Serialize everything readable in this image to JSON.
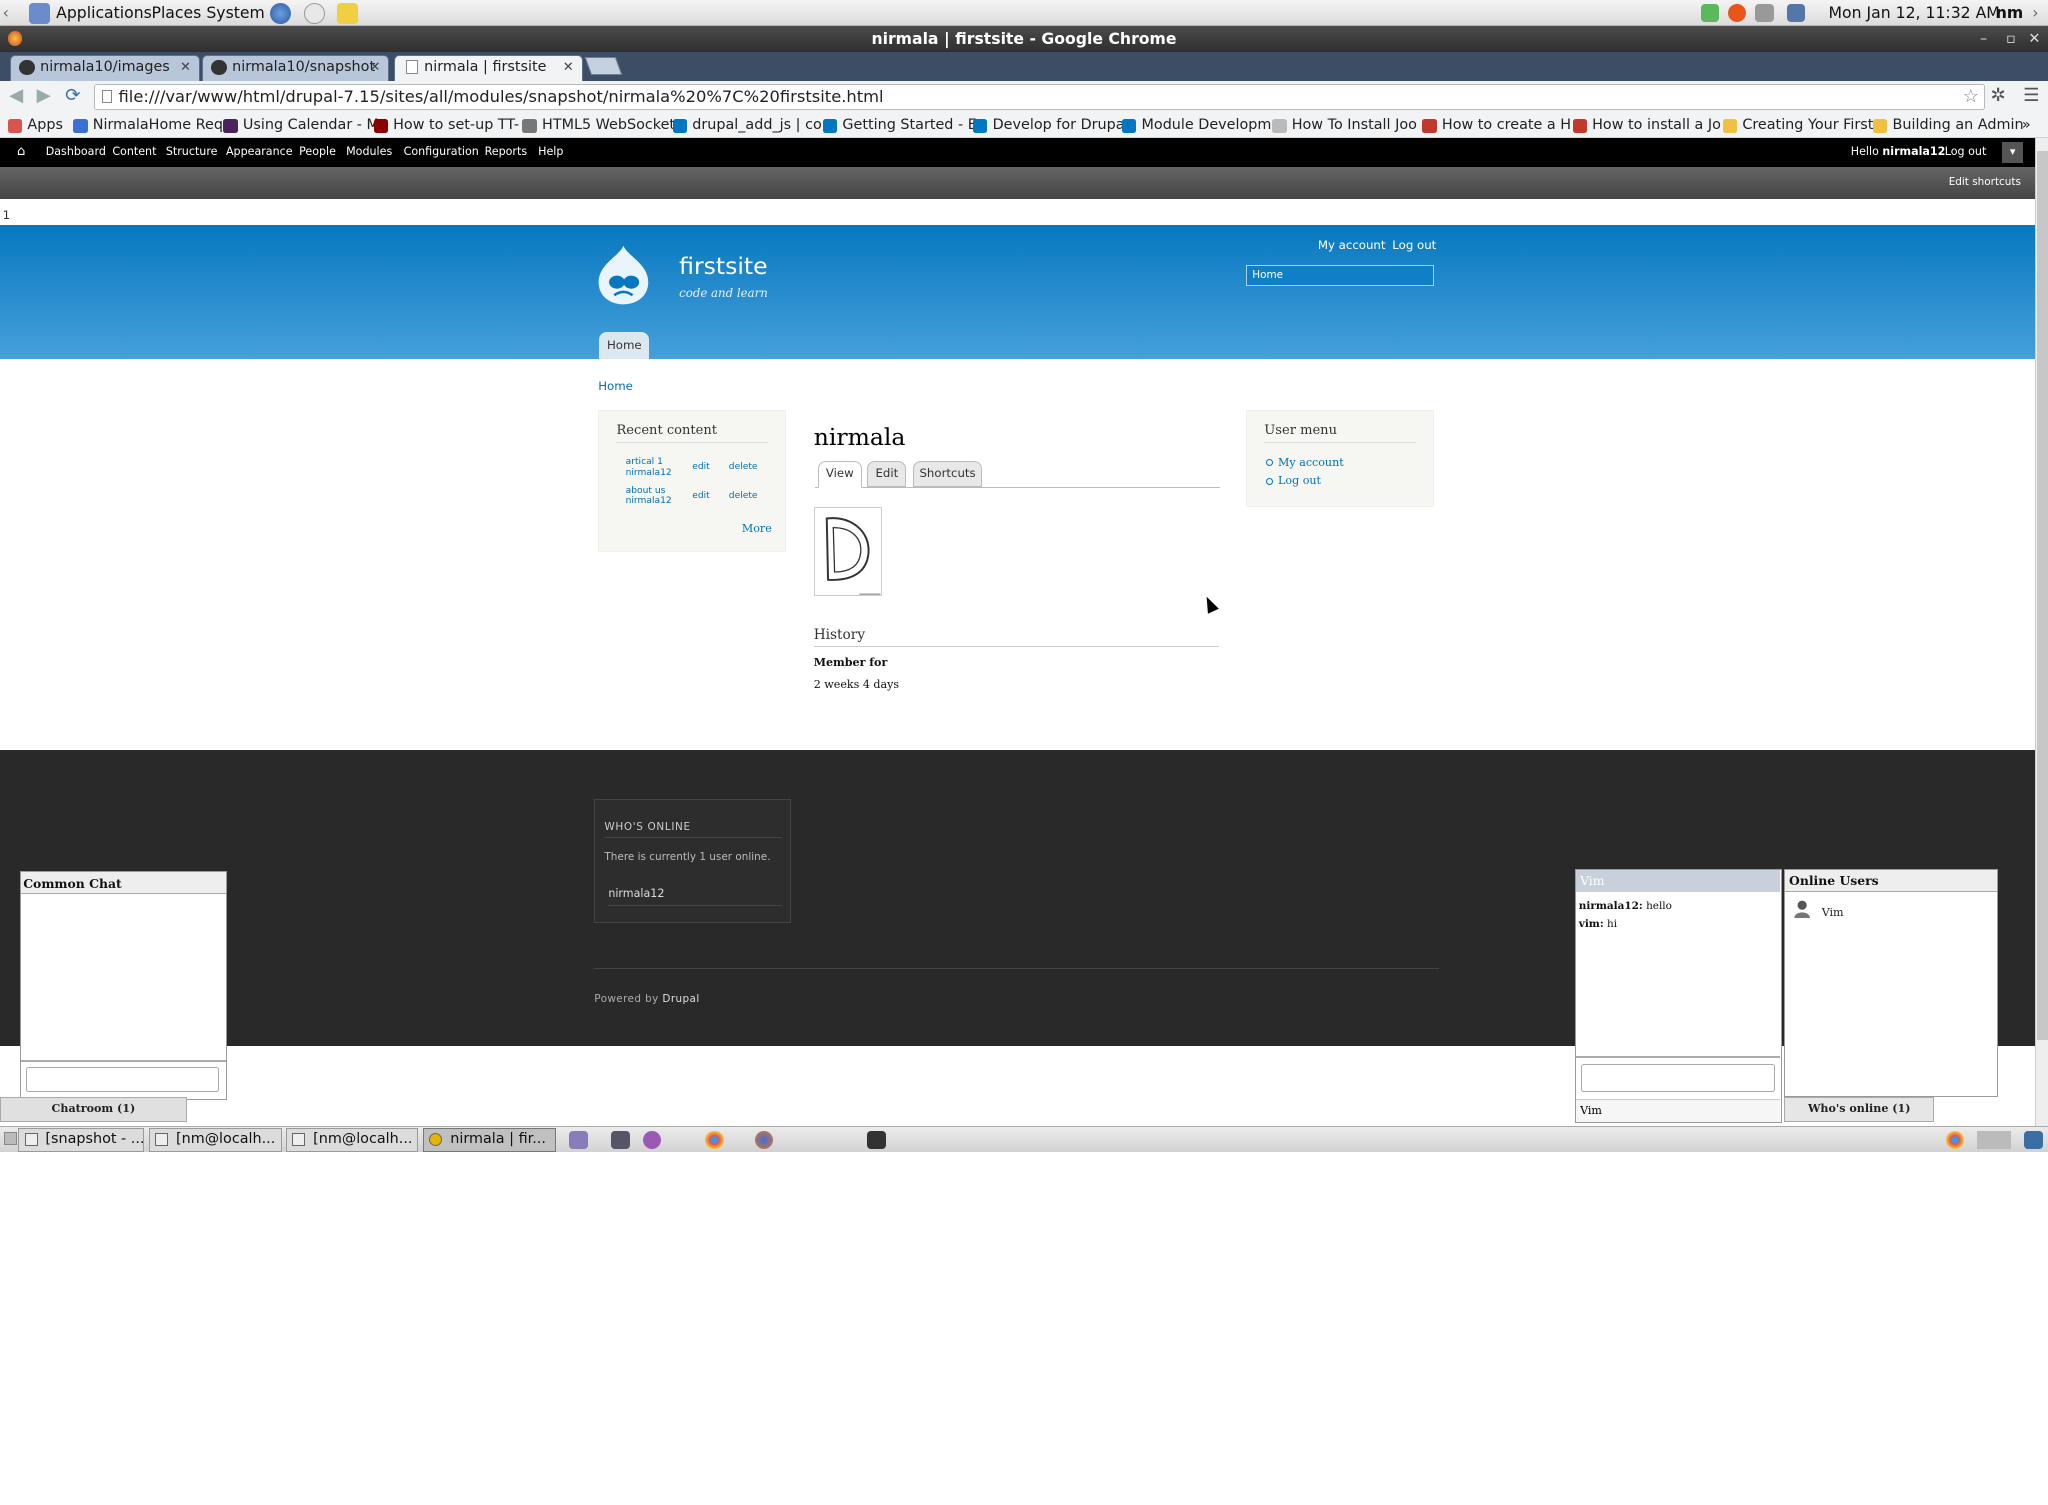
{
  "gnome_panel": {
    "menus": [
      "Applications",
      "Places",
      "System"
    ],
    "clock": "Mon Jan 12, 11:32 AM",
    "user": "nm"
  },
  "window": {
    "title": "nirmala | firstsite - Google Chrome"
  },
  "tabs": [
    {
      "label": "nirmala10/images"
    },
    {
      "label": "nirmala10/snapshot"
    },
    {
      "label": "nirmala | firstsite"
    }
  ],
  "url": "file:///var/www/html/drupal-7.15/sites/all/modules/snapshot/nirmala%20%7C%20firstsite.html",
  "bookmarks": [
    {
      "label": "Apps",
      "color": "#d9534f"
    },
    {
      "label": "NirmalaHome Req",
      "color": "#3b6fd6"
    },
    {
      "label": "Using Calendar - M",
      "color": "#4a235a"
    },
    {
      "label": "How to set-up TT-",
      "color": "#8b0000"
    },
    {
      "label": "HTML5 WebSocket",
      "color": "#777777"
    },
    {
      "label": "drupal_add_js | co",
      "color": "#0077c0"
    },
    {
      "label": "Getting Started - E",
      "color": "#0077c0"
    },
    {
      "label": "Develop for Drupa",
      "color": "#0077c0"
    },
    {
      "label": "Module Developm",
      "color": "#0077c0"
    },
    {
      "label": "How To Install Joo",
      "color": "#bbbbbb"
    },
    {
      "label": "How to create a H",
      "color": "#c0392b"
    },
    {
      "label": "How to install a Jo",
      "color": "#c0392b"
    },
    {
      "label": "Creating Your First",
      "color": "#f0c040"
    },
    {
      "label": "Building an Admin",
      "color": "#f0c040"
    }
  ],
  "admin_menu": {
    "items": [
      "Dashboard",
      "Content",
      "Structure",
      "Appearance",
      "People",
      "Modules",
      "Configuration",
      "Reports",
      "Help"
    ],
    "hello_prefix": "Hello",
    "username": "nirmala12",
    "logout": "Log out",
    "edit_shortcuts": "Edit shortcuts"
  },
  "page_marker": "1",
  "site": {
    "name": "firstsite",
    "slogan": "code and learn",
    "secondary_links": [
      "My account",
      "Log out"
    ],
    "search_value": "Home",
    "main_menu": "Home"
  },
  "breadcrumb": "Home",
  "recent_content": {
    "title": "Recent content",
    "rows": [
      {
        "title": "artical 1",
        "author": "nirmala12",
        "edit": "edit",
        "delete": "delete"
      },
      {
        "title": "about us",
        "author": "nirmala12",
        "edit": "edit",
        "delete": "delete"
      }
    ],
    "more": "More"
  },
  "profile": {
    "name": "nirmala",
    "tabs": [
      "View",
      "Edit",
      "Shortcuts"
    ],
    "history_title": "History",
    "member_for_label": "Member for",
    "member_for_value": "2 weeks 4 days"
  },
  "user_menu": {
    "title": "User menu",
    "items": [
      "My account",
      "Log out"
    ]
  },
  "whos_online": {
    "title": "WHO'S ONLINE",
    "text": "There is currently 1 user online.",
    "user": "nirmala12"
  },
  "footer": {
    "powered_prefix": "Powered by",
    "powered_link": "Drupal"
  },
  "common_chat": {
    "title": "Common Chat",
    "tab": "Chatroom (1)"
  },
  "vim_chat": {
    "title": "Vim",
    "messages": [
      {
        "from": "nirmala12:",
        "text": "hello"
      },
      {
        "from": "vim:",
        "text": "hi"
      }
    ],
    "tab": "Vim"
  },
  "online_users": {
    "title": "Online Users",
    "user": "Vim",
    "tab": "Who's online (1)"
  },
  "taskbar": {
    "tasks": [
      "[snapshot - ...",
      "[nm@localh...",
      "[nm@localh...",
      "nirmala | fir..."
    ]
  }
}
